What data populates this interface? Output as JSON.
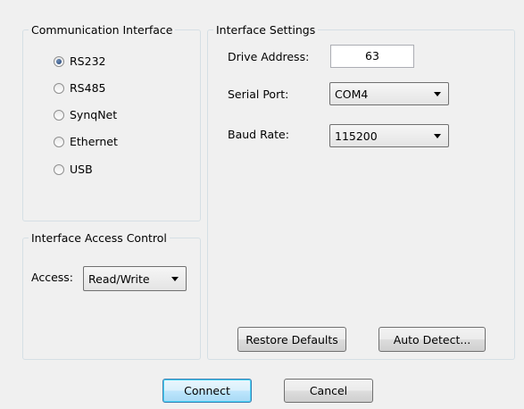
{
  "comm_interface": {
    "title": "Communication Interface",
    "options": [
      {
        "label": "RS232",
        "checked": true
      },
      {
        "label": "RS485",
        "checked": false
      },
      {
        "label": "SynqNet",
        "checked": false
      },
      {
        "label": "Ethernet",
        "checked": false
      },
      {
        "label": "USB",
        "checked": false
      }
    ]
  },
  "access_control": {
    "title": "Interface Access Control",
    "access_label": "Access:",
    "access_value": "Read/Write"
  },
  "settings": {
    "title": "Interface Settings",
    "drive_address_label": "Drive Address:",
    "drive_address_value": "63",
    "serial_port_label": "Serial Port:",
    "serial_port_value": "COM4",
    "baud_rate_label": "Baud Rate:",
    "baud_rate_value": "115200",
    "restore_defaults": "Restore Defaults",
    "auto_detect": "Auto Detect..."
  },
  "footer": {
    "connect": "Connect",
    "cancel": "Cancel"
  },
  "icons": {
    "dropdown": "chevron-down-icon"
  }
}
